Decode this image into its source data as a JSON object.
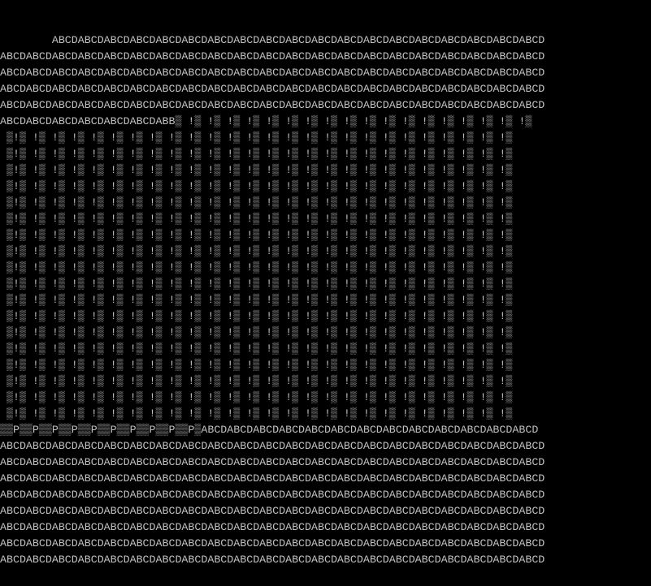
{
  "terminal": {
    "background": "#000000",
    "foreground": "#c0c0c0",
    "lines": [
      "",
      "                                                                                                                                                  \"",
      "        ABCDABCDABCDABCDABCDABCDABCDABCDABCDABCDABCDABCDABCDABCDABCDABCDABCDABCDABCD",
      "ABCDABCDABCDABCDABCDABCDABCDABCDABCDABCDABCDABCDABCDABCDABCDABCDABCDABCDABCDABCDABCD",
      "ABCDABCDABCDABCDABCDABCDABCDABCDABCDABCDABCDABCDABCDABCDABCDABCDABCDABCDABCDABCDABCD",
      "ABCDABCDABCDABCDABCDABCDABCDABCDABCDABCDABCDABCDABCDABCDABCDABCDABCDABCDABCDABCDABCD",
      "ABCDABCDABCDABCDABCDABCDABCDABCDABCDABCDABCDABCDABCDABCDABCDABCDABCDABCDABCDABCDABCD",
      "ABCDABCDABCDABCDABCDABCDABB▒ !▒ !▒ !▒ !▒ !▒ !▒ !▒ !▒ !▒ !▒ !▒ !▒ !▒ !▒ !▒ !▒ !▒ !▒",
      " ▒!▒ !▒ !▒ !▒ !▒ !▒ !▒ !▒ !▒ !▒ !▒ !▒ !▒ !▒ !▒ !▒ !▒ !▒ !▒ !▒ !▒ !▒ !▒ !▒ !▒ !▒",
      " ▒!▒ !▒ !▒ !▒ !▒ !▒ !▒ !▒ !▒ !▒ !▒ !▒ !▒ !▒ !▒ !▒ !▒ !▒ !▒ !▒ !▒ !▒ !▒ !▒ !▒ !▒",
      " ▒!▒ !▒ !▒ !▒ !▒ !▒ !▒ !▒ !▒ !▒ !▒ !▒ !▒ !▒ !▒ !▒ !▒ !▒ !▒ !▒ !▒ !▒ !▒ !▒ !▒ !▒",
      " ▒!▒ !▒ !▒ !▒ !▒ !▒ !▒ !▒ !▒ !▒ !▒ !▒ !▒ !▒ !▒ !▒ !▒ !▒ !▒ !▒ !▒ !▒ !▒ !▒ !▒ !▒",
      " ▒!▒ !▒ !▒ !▒ !▒ !▒ !▒ !▒ !▒ !▒ !▒ !▒ !▒ !▒ !▒ !▒ !▒ !▒ !▒ !▒ !▒ !▒ !▒ !▒ !▒ !▒",
      " ▒!▒ !▒ !▒ !▒ !▒ !▒ !▒ !▒ !▒ !▒ !▒ !▒ !▒ !▒ !▒ !▒ !▒ !▒ !▒ !▒ !▒ !▒ !▒ !▒ !▒ !▒",
      " ▒!▒ !▒ !▒ !▒ !▒ !▒ !▒ !▒ !▒ !▒ !▒ !▒ !▒ !▒ !▒ !▒ !▒ !▒ !▒ !▒ !▒ !▒ !▒ !▒ !▒ !▒",
      " ▒!▒ !▒ !▒ !▒ !▒ !▒ !▒ !▒ !▒ !▒ !▒ !▒ !▒ !▒ !▒ !▒ !▒ !▒ !▒ !▒ !▒ !▒ !▒ !▒ !▒ !▒",
      " ▒!▒ !▒ !▒ !▒ !▒ !▒ !▒ !▒ !▒ !▒ !▒ !▒ !▒ !▒ !▒ !▒ !▒ !▒ !▒ !▒ !▒ !▒ !▒ !▒ !▒ !▒",
      " ▒!▒ !▒ !▒ !▒ !▒ !▒ !▒ !▒ !▒ !▒ !▒ !▒ !▒ !▒ !▒ !▒ !▒ !▒ !▒ !▒ !▒ !▒ !▒ !▒ !▒ !▒",
      " ▒!▒ !▒ !▒ !▒ !▒ !▒ !▒ !▒ !▒ !▒ !▒ !▒ !▒ !▒ !▒ !▒ !▒ !▒ !▒ !▒ !▒ !▒ !▒ !▒ !▒ !▒",
      " ▒!▒ !▒ !▒ !▒ !▒ !▒ !▒ !▒ !▒ !▒ !▒ !▒ !▒ !▒ !▒ !▒ !▒ !▒ !▒ !▒ !▒ !▒ !▒ !▒ !▒ !▒",
      " ▒!▒ !▒ !▒ !▒ !▒ !▒ !▒ !▒ !▒ !▒ !▒ !▒ !▒ !▒ !▒ !▒ !▒ !▒ !▒ !▒ !▒ !▒ !▒ !▒ !▒ !▒",
      " ▒!▒ !▒ !▒ !▒ !▒ !▒ !▒ !▒ !▒ !▒ !▒ !▒ !▒ !▒ !▒ !▒ !▒ !▒ !▒ !▒ !▒ !▒ !▒ !▒ !▒ !▒",
      " ▒!▒ !▒ !▒ !▒ !▒ !▒ !▒ !▒ !▒ !▒ !▒ !▒ !▒ !▒ !▒ !▒ !▒ !▒ !▒ !▒ !▒ !▒ !▒ !▒ !▒ !▒",
      " ▒!▒ !▒ !▒ !▒ !▒ !▒ !▒ !▒ !▒ !▒ !▒ !▒ !▒ !▒ !▒ !▒ !▒ !▒ !▒ !▒ !▒ !▒ !▒ !▒ !▒ !▒",
      " ▒!▒ !▒ !▒ !▒ !▒ !▒ !▒ !▒ !▒ !▒ !▒ !▒ !▒ !▒ !▒ !▒ !▒ !▒ !▒ !▒ !▒ !▒ !▒ !▒ !▒ !▒",
      " ▒!▒ !▒ !▒ !▒ !▒ !▒ !▒ !▒ !▒ !▒ !▒ !▒ !▒ !▒ !▒ !▒ !▒ !▒ !▒ !▒ !▒ !▒ !▒ !▒ !▒ !▒",
      "▒▒P▒▒P▒▒P▒▒P▒▒P▒▒P▒▒P▒▒P▒▒P▒▒P▒ABCDABCDABCDABCDABCDABCDABCDABCDABCDABCDABCDABCDABCD",
      "ABCDABCDABCDABCDABCDABCDABCDABCDABCDABCDABCDABCDABCDABCDABCDABCDABCDABCDABCDABCDABCD",
      "ABCDABCDABCDABCDABCDABCDABCDABCDABCDABCDABCDABCDABCDABCDABCDABCDABCDABCDABCDABCDABCD",
      "ABCDABCDABCDABCDABCDABCDABCDABCDABCDABCDABCDABCDABCDABCDABCDABCDABCDABCDABCDABCDABCD",
      "ABCDABCDABCDABCDABCDABCDABCDABCDABCDABCDABCDABCDABCDABCDABCDABCDABCDABCDABCDABCDABCD",
      "ABCDABCDABCDABCDABCDABCDABCDABCDABCDABCDABCDABCDABCDABCDABCDABCDABCDABCDABCDABCDABCD",
      "ABCDABCDABCDABCDABCDABCDABCDABCDABCDABCDABCDABCDABCDABCDABCDABCDABCDABCDABCDABCDABCD",
      "ABCDABCDABCDABCDABCDABCDABCDABCDABCDABCDABCDABCDABCDABCDABCDABCDABCDABCDABCDABCDABCD",
      "ABCDABCDABCDABCDABCDABCDABCDABCDABCDABCDABCDABCDABCDABCDABCDABCDABCDABCDABCDABCDABCD"
    ]
  }
}
